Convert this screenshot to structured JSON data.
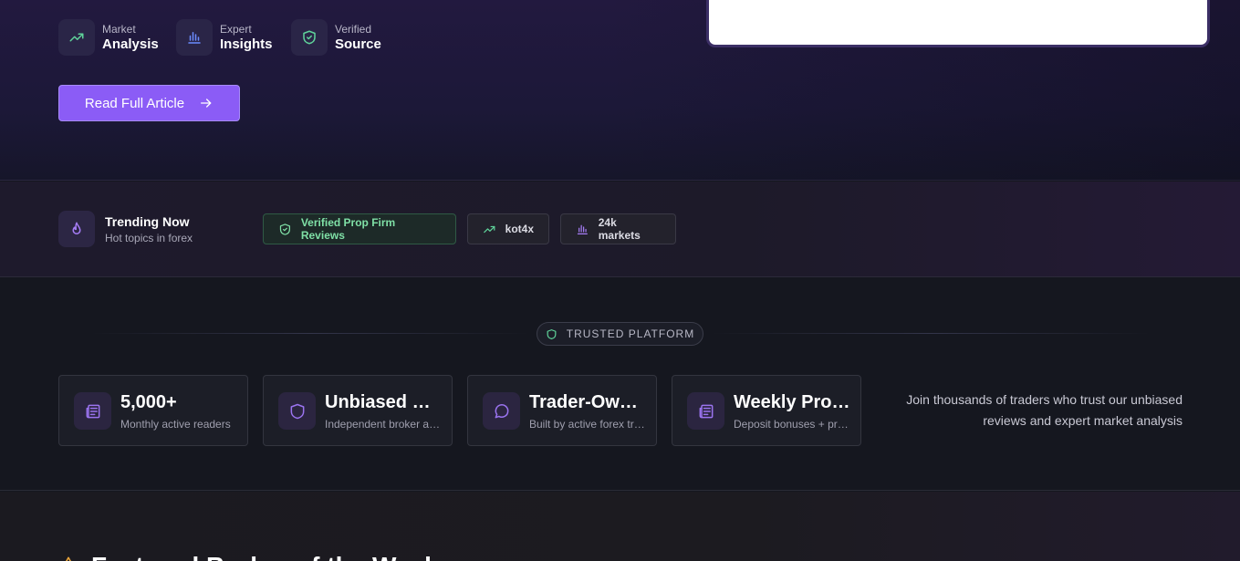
{
  "hero": {
    "features": [
      {
        "small": "Market",
        "big": "Analysis",
        "icon": "trending-up-icon"
      },
      {
        "small": "Expert",
        "big": "Insights",
        "icon": "bar-chart-icon"
      },
      {
        "small": "Verified",
        "big": "Source",
        "icon": "shield-check-icon"
      }
    ],
    "read_button": "Read Full Article"
  },
  "trending": {
    "title": "Trending Now",
    "subtitle": "Hot topics in forex",
    "chips": [
      {
        "label": "Verified Prop Firm Reviews",
        "icon": "shield-check-icon"
      },
      {
        "label": "kot4x",
        "icon": "trending-up-icon"
      },
      {
        "label": "24k markets",
        "icon": "bar-chart-icon"
      }
    ]
  },
  "trust": {
    "badge": "TRUSTED PLATFORM",
    "stats": [
      {
        "title": "5,000+",
        "subtitle": "Monthly active readers",
        "icon": "newspaper-icon"
      },
      {
        "title": "Unbiased Reviews",
        "subtitle": "Independent broker analysis",
        "icon": "shield-icon"
      },
      {
        "title": "Trader-Owned",
        "subtitle": "Built by active forex traders",
        "icon": "chat-icon"
      },
      {
        "title": "Weekly Promos",
        "subtitle": "Deposit bonuses + promotions",
        "icon": "newspaper-icon"
      }
    ],
    "join_text": "Join thousands of traders who trust our unbiased reviews and expert market analysis"
  },
  "featured": {
    "title": "Featured Broker of the Week"
  },
  "colors": {
    "accent": "#8b5cf6",
    "green": "#7fe0a6",
    "background": "#15171f"
  }
}
